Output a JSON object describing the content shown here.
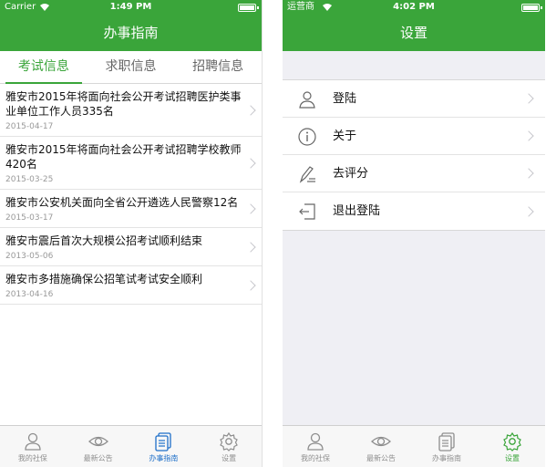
{
  "left": {
    "status": {
      "carrier": "Carrier",
      "time": "1:49 PM"
    },
    "title": "办事指南",
    "tabs": [
      "考试信息",
      "求职信息",
      "招聘信息"
    ],
    "news": [
      {
        "title": "雅安市2015年将面向社会公开考试招聘医护类事业单位工作人员335名",
        "date": "2015-04-17"
      },
      {
        "title": "雅安市2015年将面向社会公开考试招聘学校教师420名",
        "date": "2015-03-25"
      },
      {
        "title": "雅安市公安机关面向全省公开遴选人民警察12名",
        "date": "2015-03-17"
      },
      {
        "title": "雅安市震后首次大规模公招考试顺利结束",
        "date": "2013-05-06"
      },
      {
        "title": "雅安市多措施确保公招笔试考试安全顺利",
        "date": "2013-04-16"
      }
    ],
    "tabbar": [
      "我的社保",
      "最新公告",
      "办事指南",
      "设置"
    ]
  },
  "right": {
    "status": {
      "carrier": "运营商",
      "time": "4:02 PM"
    },
    "title": "设置",
    "settings": [
      {
        "label": "登陆",
        "icon": "user-icon"
      },
      {
        "label": "关于",
        "icon": "info-icon"
      },
      {
        "label": "去评分",
        "icon": "pen-icon"
      },
      {
        "label": "退出登陆",
        "icon": "logout-icon"
      }
    ],
    "tabbar": [
      "我的社保",
      "最新公告",
      "办事指南",
      "设置"
    ]
  },
  "colors": {
    "brand_green": "#3aa53a",
    "active_tab_blue": "#1e6fc9",
    "active_settings_green": "#3aa53a"
  }
}
